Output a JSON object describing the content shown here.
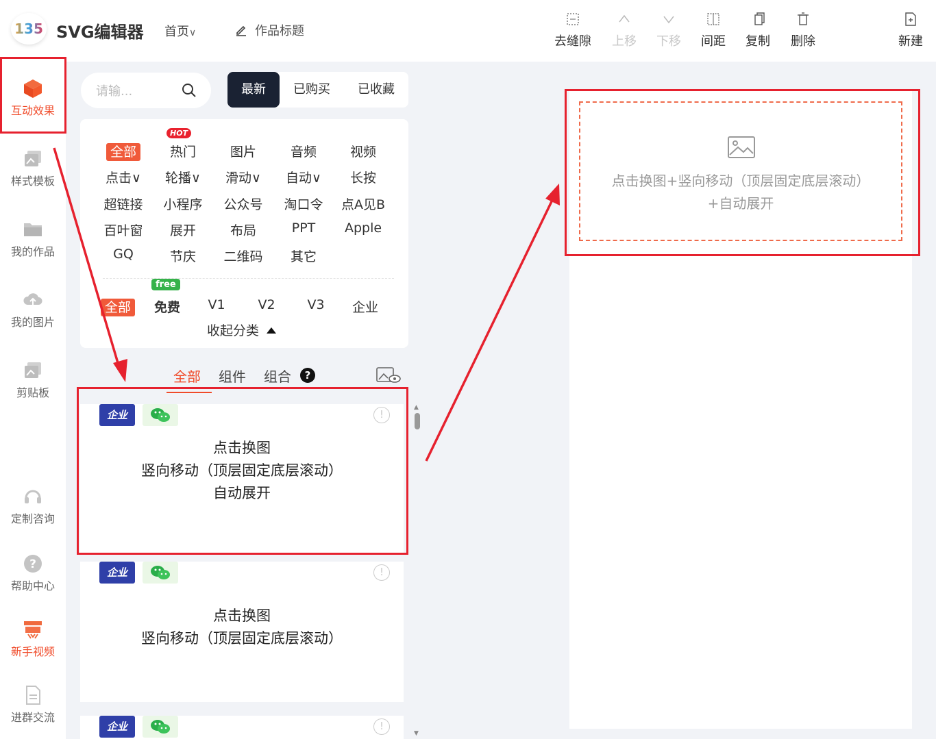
{
  "header": {
    "logo_mark": "135",
    "logo_text": "SVG编辑器",
    "home_label": "首页",
    "title_label": "作品标题",
    "tools": [
      {
        "label": "去缝隙",
        "icon": "gap-icon",
        "disabled": false
      },
      {
        "label": "上移",
        "icon": "chevron-up-icon",
        "disabled": true
      },
      {
        "label": "下移",
        "icon": "chevron-down-icon",
        "disabled": true
      },
      {
        "label": "间距",
        "icon": "spacing-icon",
        "disabled": false
      },
      {
        "label": "复制",
        "icon": "copy-icon",
        "disabled": false
      },
      {
        "label": "删除",
        "icon": "trash-icon",
        "disabled": false
      },
      {
        "label": "新建",
        "icon": "new-file-icon",
        "disabled": false
      }
    ]
  },
  "rail": {
    "items": [
      {
        "label": "互动效果",
        "icon": "cube-icon",
        "active": true
      },
      {
        "label": "样式模板",
        "icon": "template-icon",
        "active": false
      },
      {
        "label": "我的作品",
        "icon": "folder-icon",
        "active": false
      },
      {
        "label": "我的图片",
        "icon": "cloud-icon",
        "active": false
      },
      {
        "label": "剪贴板",
        "icon": "clipboard-icon",
        "active": false
      },
      {
        "label": "定制咨询",
        "icon": "headset-icon",
        "active": false
      },
      {
        "label": "帮助中心",
        "icon": "help-icon",
        "active": false
      },
      {
        "label": "新手视频",
        "icon": "video-icon",
        "active": false
      },
      {
        "label": "进群交流",
        "icon": "document-icon",
        "active": false
      }
    ]
  },
  "search": {
    "placeholder": "请输..."
  },
  "segments": [
    "最新",
    "已购买",
    "已收藏"
  ],
  "categories": {
    "rows": [
      [
        "全部",
        "热门",
        "图片",
        "音频",
        "视频"
      ],
      [
        "点击∨",
        "轮播∨",
        "滑动∨",
        "自动∨",
        "长按"
      ],
      [
        "超链接",
        "小程序",
        "公众号",
        "淘口令",
        "点A见B"
      ],
      [
        "百叶窗",
        "展开",
        "布局",
        "PPT",
        "Apple"
      ],
      [
        "GQ",
        "节庆",
        "二维码",
        "其它"
      ]
    ],
    "hot_badge": "HOT",
    "tier_row": [
      "全部",
      "免费",
      "V1",
      "V2",
      "V3",
      "企业"
    ],
    "free_badge": "free",
    "collapse_label": "收起分类"
  },
  "sub_tabs": [
    "全部",
    "组件",
    "组合"
  ],
  "cards": [
    {
      "badge_enterprise": "企业",
      "lines": [
        "点击换图",
        "竖向移动（顶层固定底层滚动）",
        "自动展开"
      ]
    },
    {
      "badge_enterprise": "企业",
      "lines": [
        "点击换图",
        "竖向移动（顶层固定底层滚动）"
      ]
    },
    {
      "badge_enterprise": "企业",
      "lines": []
    }
  ],
  "canvas": {
    "placeholder_lines": [
      "点击换图+竖向移动（顶层固定底层滚动）",
      "+自动展开"
    ]
  },
  "colors": {
    "accent": "#f04b2a",
    "annotation": "#e6212e",
    "dark": "#1a2233"
  }
}
